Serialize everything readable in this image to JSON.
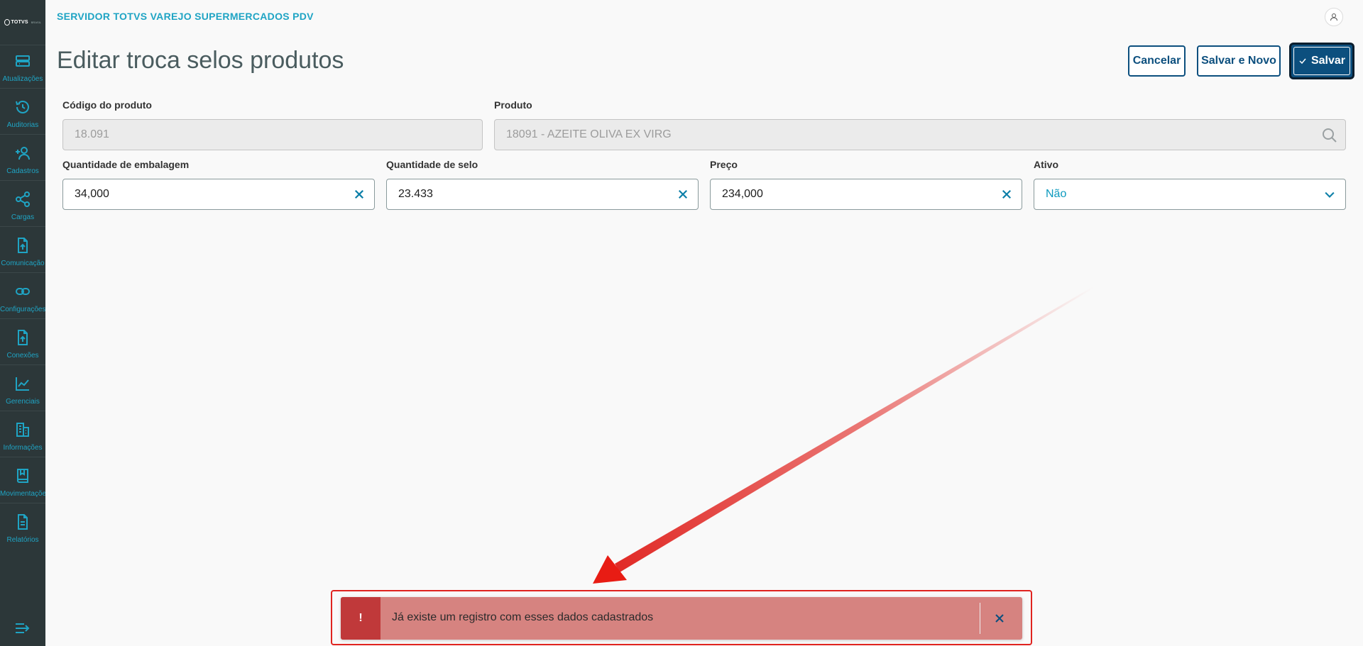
{
  "app": {
    "logo_text": "TOTVS",
    "logo_sub": "BRASIL",
    "header_title": "SERVIDOR TOTVS VAREJO SUPERMERCADOS PDV"
  },
  "sidebar": {
    "items": [
      {
        "label": "Atualizações",
        "icon": "server-icon"
      },
      {
        "label": "Auditorias",
        "icon": "history-icon"
      },
      {
        "label": "Cadastros",
        "icon": "add-user-icon"
      },
      {
        "label": "Cargas",
        "icon": "share-icon"
      },
      {
        "label": "Comunicação",
        "icon": "file-upload-icon"
      },
      {
        "label": "Configurações",
        "icon": "link-icon"
      },
      {
        "label": "Conexões",
        "icon": "file-upload-icon"
      },
      {
        "label": "Gerenciais",
        "icon": "chart-line-icon"
      },
      {
        "label": "Informações",
        "icon": "building-icon"
      },
      {
        "label": "Movimentações",
        "icon": "book-icon"
      },
      {
        "label": "Relatórios",
        "icon": "document-icon"
      }
    ]
  },
  "page": {
    "title": "Editar troca selos produtos"
  },
  "actions": {
    "cancel_label": "Cancelar",
    "save_new_label": "Salvar e Novo",
    "save_label": "Salvar"
  },
  "form": {
    "codigo": {
      "label": "Código do produto",
      "value": "18.091"
    },
    "produto": {
      "label": "Produto",
      "value": "18091 - AZEITE OLIVA EX VIRG"
    },
    "qtd_embalagem": {
      "label": "Quantidade de embalagem",
      "value": "34,000"
    },
    "qtd_selo": {
      "label": "Quantidade de selo",
      "value": "23.433"
    },
    "preco": {
      "label": "Preço",
      "value": "234,000"
    },
    "ativo": {
      "label": "Ativo",
      "value": "Não"
    }
  },
  "toast": {
    "icon_glyph": "!",
    "message": "Já existe um registro com esses dados cadastrados"
  },
  "colors": {
    "accent": "#1fa4c4",
    "primary": "#0c4f7e",
    "sidebar_bg": "#2c3739",
    "toast_bg": "#d68380",
    "toast_icon_bg": "#c0393a",
    "annotation_red": "#e0231f"
  }
}
